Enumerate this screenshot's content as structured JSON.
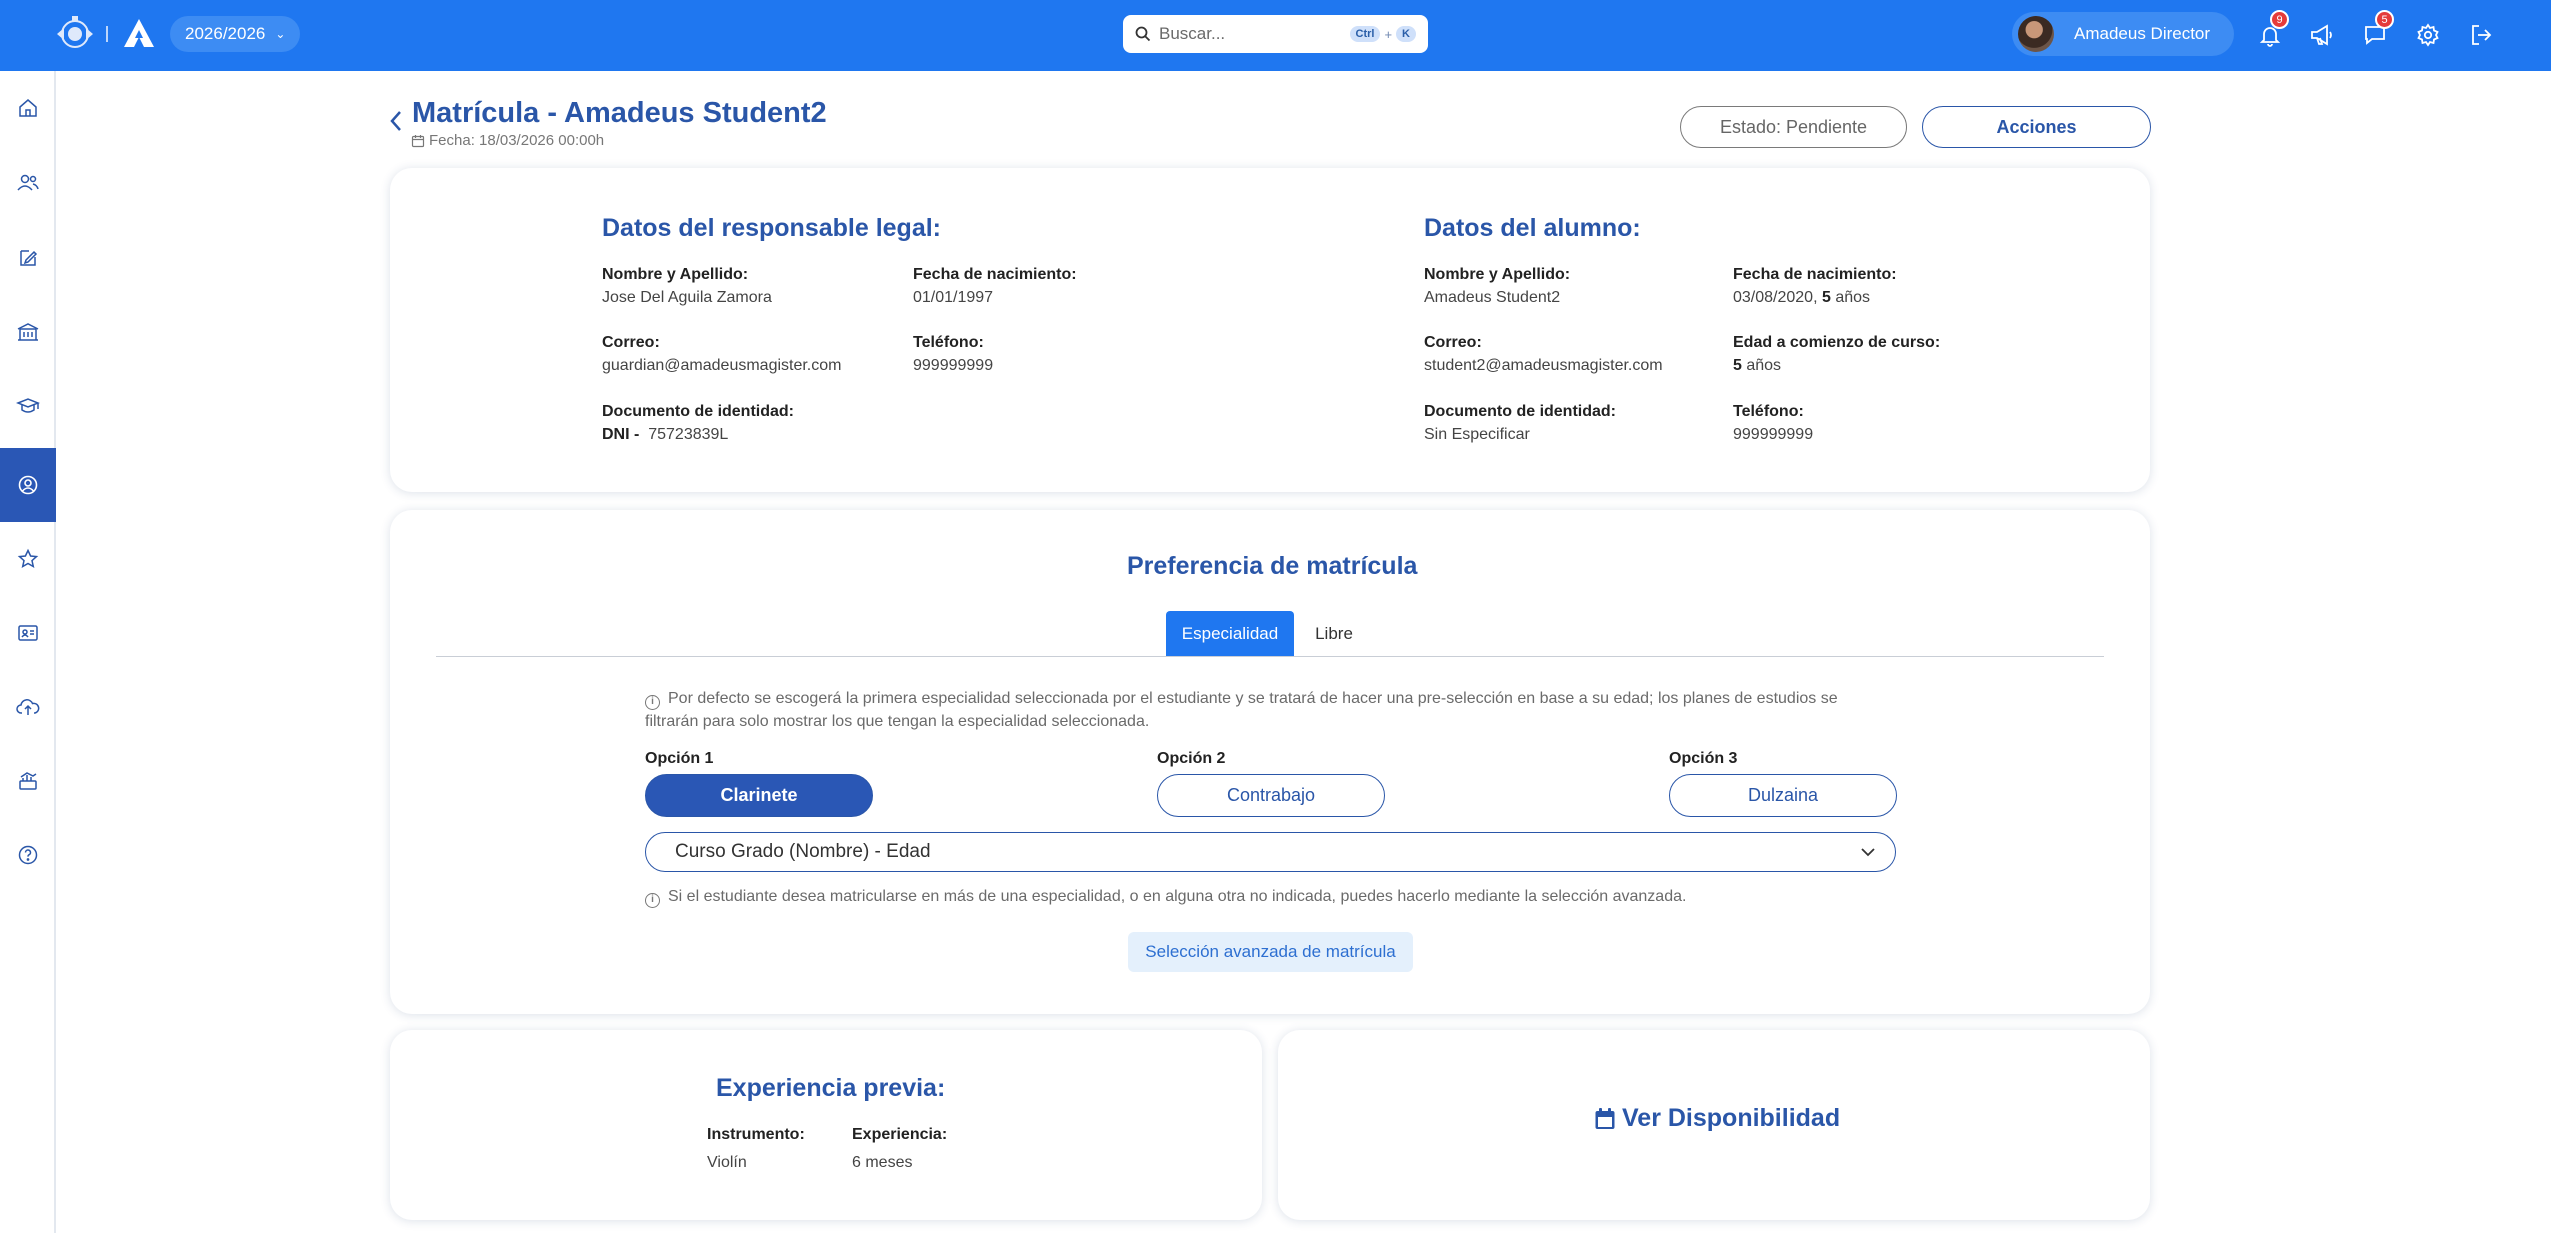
{
  "topbar": {
    "year_label": "2026/2026",
    "search_placeholder": "Buscar...",
    "shortcut_ctrl": "Ctrl",
    "shortcut_plus": "+",
    "shortcut_key": "K",
    "user_name": "Amadeus Director",
    "notifications_badge": "9",
    "messages_badge": "5"
  },
  "header": {
    "title": "Matrícula - Amadeus Student2",
    "date": "Fecha: 18/03/2026 00:00h",
    "state_label": "Estado: Pendiente",
    "actions_label": "Acciones"
  },
  "guardian": {
    "title": "Datos del responsable legal:",
    "name_label": "Nombre y Apellido:",
    "name_value": "Jose Del Aguila Zamora",
    "birth_label": "Fecha de nacimiento:",
    "birth_value": "01/01/1997",
    "email_label": "Correo:",
    "email_value": "guardian@amadeusmagister.com",
    "phone_label": "Teléfono:",
    "phone_value": "999999999",
    "doc_label": "Documento de identidad:",
    "doc_type": "DNI -",
    "doc_value": "75723839L"
  },
  "student": {
    "title": "Datos del alumno:",
    "name_label": "Nombre y Apellido:",
    "name_value": "Amadeus Student2",
    "birth_label": "Fecha de nacimiento:",
    "birth_value": "03/08/2020,",
    "birth_age_num": "5",
    "birth_age_unit": "años",
    "email_label": "Correo:",
    "email_value": "student2@amadeusmagister.com",
    "age_start_label": "Edad a comienzo de curso:",
    "age_start_num": "5",
    "age_start_unit": "años",
    "doc_label": "Documento de identidad:",
    "doc_value": "Sin Especificar",
    "phone_label": "Teléfono:",
    "phone_value": "999999999"
  },
  "preference": {
    "title": "Preferencia de matrícula",
    "tabs": [
      "Especialidad",
      "Libre"
    ],
    "info_default": "Por defecto se escogerá la primera especialidad seleccionada por el estudiante y se tratará de hacer una pre-selección en base a su edad; los planes de estudios se filtrarán para solo mostrar los que tengan la especialidad seleccionada.",
    "options": [
      {
        "label": "Opción 1",
        "value": "Clarinete"
      },
      {
        "label": "Opción 2",
        "value": "Contrabajo"
      },
      {
        "label": "Opción 3",
        "value": "Dulzaina"
      }
    ],
    "course_select": "Curso Grado (Nombre) - Edad",
    "info_advanced": "Si el estudiante desea matricularse en más de una especialidad, o en alguna otra no indicada, puedes hacerlo mediante la selección avanzada.",
    "advanced_button": "Selección avanzada de matrícula"
  },
  "experience": {
    "title": "Experiencia previa:",
    "instrument_label": "Instrumento:",
    "instrument_value": "Violín",
    "experience_label": "Experiencia:",
    "experience_value": "6 meses"
  },
  "availability": {
    "label": "Ver Disponibilidad"
  },
  "colors": {
    "primary": "#1f77f0",
    "dark_blue": "#2a56a8",
    "badge_red": "#e43b3b"
  }
}
